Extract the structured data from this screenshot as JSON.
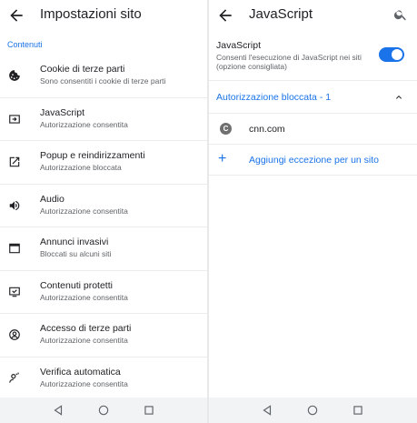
{
  "left": {
    "title": "Impostazioni sito",
    "section": "Contenuti",
    "items": [
      {
        "title": "Cookie di terze parti",
        "subtitle": "Sono consentiti i cookie di terze parti",
        "icon": "cookie-icon"
      },
      {
        "title": "JavaScript",
        "subtitle": "Autorizzazione consentita",
        "icon": "code-icon"
      },
      {
        "title": "Popup e reindirizzamenti",
        "subtitle": "Autorizzazione bloccata",
        "icon": "open-in-new-icon"
      },
      {
        "title": "Audio",
        "subtitle": "Autorizzazione consentita",
        "icon": "volume-icon"
      },
      {
        "title": "Annunci invasivi",
        "subtitle": "Bloccati su alcuni siti",
        "icon": "window-icon"
      },
      {
        "title": "Contenuti protetti",
        "subtitle": "Autorizzazione consentita",
        "icon": "protected-content-icon"
      },
      {
        "title": "Accesso di terze parti",
        "subtitle": "Autorizzazione consentita",
        "icon": "account-circle-icon"
      },
      {
        "title": "Verifica automatica",
        "subtitle": "Autorizzazione consentita",
        "icon": "person-verify-icon"
      }
    ]
  },
  "right": {
    "title": "JavaScript",
    "toggle": {
      "title": "JavaScript",
      "subtitle": "Consenti l'esecuzione di JavaScript nei siti (opzione consigliata)",
      "state": "on"
    },
    "blocked_header": "Autorizzazione bloccata - 1",
    "site": {
      "favicon_letter": "C",
      "domain": "cnn.com"
    },
    "add_exception": "Aggiungi eccezione per un sito"
  },
  "colors": {
    "accent": "#1a73e8",
    "text": "#202124",
    "secondary": "#5f6368",
    "navbar": "#f1f3f4"
  }
}
